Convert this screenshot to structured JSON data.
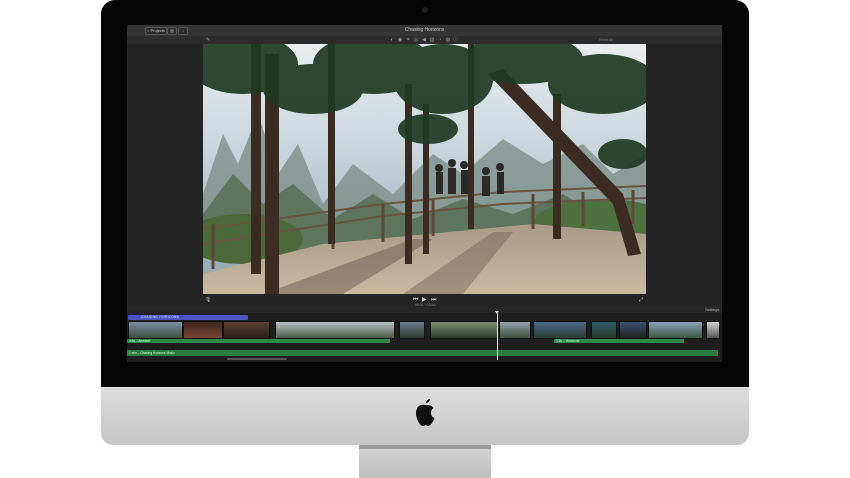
{
  "app": {
    "title": "Chasing Horizons",
    "projects_button": "< Projects",
    "reset_all": "Reset All"
  },
  "viewer": {
    "timecode": "00:31 / 03:20"
  },
  "timeline": {
    "settings_label": "Settings",
    "title_clip": "CHASING HORIZONS",
    "audio_clips": [
      "3.6s – Ambient",
      "3.6s – Voiceover"
    ],
    "music_track": "1 min – Chasing Horizons Music"
  },
  "colors": {
    "title_clip": "#4d55c4",
    "audio": "#2e8a4c",
    "bezel": "#050505",
    "app_background": "#242424"
  },
  "icons": [
    "apple-logo-icon",
    "play-icon",
    "skip-back-icon",
    "skip-forward-icon",
    "microphone-icon",
    "fullscreen-icon",
    "crop-icon",
    "color-icon",
    "volume-icon",
    "speed-icon",
    "info-icon"
  ]
}
